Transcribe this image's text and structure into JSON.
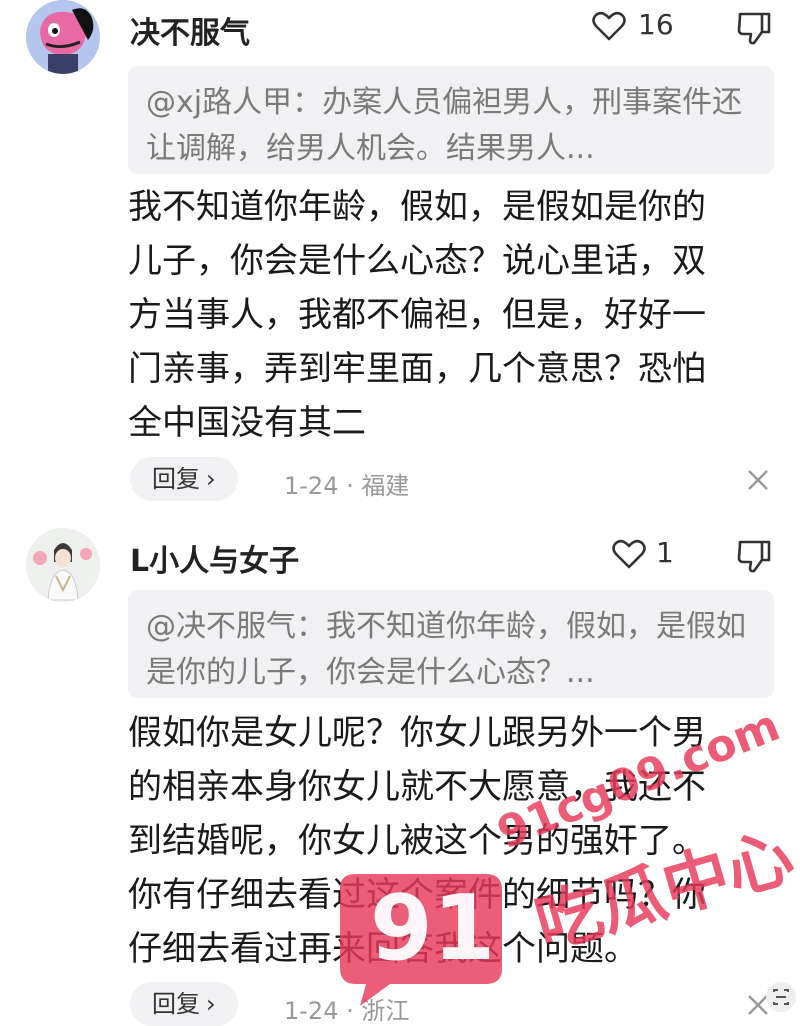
{
  "comments": [
    {
      "username": "决不服气",
      "likes": "16",
      "quote": "@xj路人甲：办案人员偏袒男人，刑事案件还让调解，给男人机会。结果男人...",
      "body_lines": [
        "我不知道你年龄，假如，是假如是你的",
        "儿子，你会是什么心态？说心里话，双",
        "方当事人，我都不偏袒，但是，好好一",
        "门亲事，弄到牢里面，几个意思？恐怕",
        "全中国没有其二"
      ],
      "reply_label": "回复",
      "meta": "1-24 · 福建"
    },
    {
      "username": "L小人与女子",
      "likes": "1",
      "quote": "@决不服气：我不知道你年龄，假如，是假如是你的儿子，你会是什么心态？...",
      "body_lines": [
        "假如你是女儿呢？你女儿跟另外一个男",
        "的相亲本身你女儿就不大愿意，我还不",
        "到结婚呢，你女儿被这个男的强奸了。",
        "你有仔细去看过这个案件的细节吗？你",
        "仔细去看过再来回答我这个问题。"
      ],
      "reply_label": "回复",
      "meta": "1-24 · 浙江"
    }
  ],
  "watermark": {
    "badge": "91",
    "url": "91cg09.com",
    "brand": "吃瓜中心"
  },
  "colors": {
    "watermark": "#e8395a",
    "quote_bg": "#f1f1f3",
    "meta": "#999999"
  }
}
